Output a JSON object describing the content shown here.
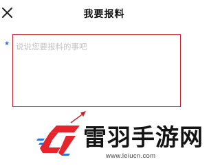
{
  "header": {
    "title": "我要报料"
  },
  "form": {
    "required_marker": "★",
    "report_placeholder": "说说您要报料的事吧",
    "report_value": ""
  },
  "watermark": {
    "site_name": "雷羽手游网",
    "url": "www.leiucn.com"
  },
  "colors": {
    "accent_red": "#c8232c",
    "required_star": "#2f6fd6",
    "logo_red": "#e5242c",
    "logo_blue": "#2b7bd6"
  },
  "icons": {
    "close": "close-icon",
    "logo": "site-logo-icon",
    "arrow": "arrow-decoration"
  }
}
